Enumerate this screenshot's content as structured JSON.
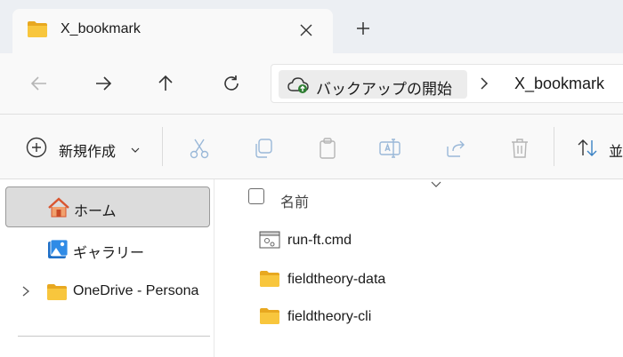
{
  "tab": {
    "title": "X_bookmark",
    "close_icon": "close-icon",
    "new_tab_icon": "plus-icon"
  },
  "nav": {
    "back_icon": "arrow-left-icon",
    "forward_icon": "arrow-right-icon",
    "up_icon": "arrow-up-icon",
    "refresh_icon": "refresh-icon"
  },
  "address": {
    "backup_label": "バックアップの開始",
    "separator_icon": "chevron-right-icon",
    "current": "X_bookmark"
  },
  "commandbar": {
    "new_label": "新規作成",
    "cut_icon": "scissors-icon",
    "copy_icon": "copy-icon",
    "paste_icon": "clipboard-icon",
    "rename_icon": "rename-icon",
    "share_icon": "share-icon",
    "delete_icon": "trash-icon",
    "sort_label": "並"
  },
  "sidebar": {
    "items": [
      {
        "label": "ホーム",
        "icon": "home-icon",
        "selected": true
      },
      {
        "label": "ギャラリー",
        "icon": "gallery-icon",
        "selected": false
      },
      {
        "label": "OneDrive - Persona",
        "icon": "folder-icon",
        "selected": false
      }
    ]
  },
  "filelist": {
    "header_name": "名前",
    "files": [
      {
        "name": "run-ft.cmd",
        "icon": "cmd-file-icon"
      },
      {
        "name": "fieldtheory-data",
        "icon": "folder-icon"
      },
      {
        "name": "fieldtheory-cli",
        "icon": "folder-icon"
      }
    ]
  },
  "colors": {
    "titlebar_bg": "#eceff3",
    "toolbar_bg": "#f9f9f9",
    "selected_bg": "#dcdcdc",
    "folder_yellow": "#f8c63d",
    "icon_accent": "#3b82c4"
  }
}
